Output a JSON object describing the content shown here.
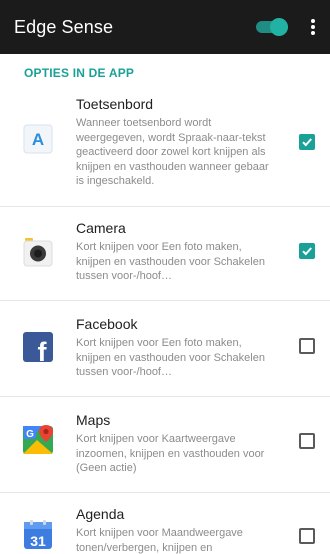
{
  "header": {
    "title": "Edge Sense",
    "master_switch_on": true,
    "menu_icon": "overflow-menu-icon"
  },
  "section": {
    "title": "OPTIES IN DE APP"
  },
  "items": [
    {
      "name": "Toetsenbord",
      "icon": "keyboard-app-icon",
      "icon_letter": "A",
      "desc": "Wanneer toetsenbord wordt weergegeven, wordt Spraak-naar-tekst geactiveerd door zowel kort knijpen als knijpen en vasthouden wanneer gebaar is ingeschakeld.",
      "checked": true
    },
    {
      "name": "Camera",
      "icon": "camera-app-icon",
      "desc": "Kort knijpen voor Een foto maken, knijpen en vasthouden voor Schakelen tussen voor-/hoof…",
      "checked": true
    },
    {
      "name": "Facebook",
      "icon": "facebook-app-icon",
      "icon_letter": "f",
      "desc": "Kort knijpen voor Een foto maken, knijpen en vasthouden voor Schakelen tussen voor-/hoof…",
      "checked": false
    },
    {
      "name": "Maps",
      "icon": "maps-app-icon",
      "icon_letter": "G",
      "desc": "Kort knijpen voor Kaartweergave inzoomen, knijpen en vasthouden voor (Geen actie)",
      "checked": false
    },
    {
      "name": "Agenda",
      "icon": "calendar-app-icon",
      "icon_number": "31",
      "desc": "Kort knijpen voor Maandweergave tonen/verbergen, knijpen en",
      "checked": false
    }
  ],
  "colors": {
    "accent": "#1aa197",
    "topbar": "#1b1b1b",
    "facebook": "#3b5998",
    "calendar": "#3e7de0"
  }
}
